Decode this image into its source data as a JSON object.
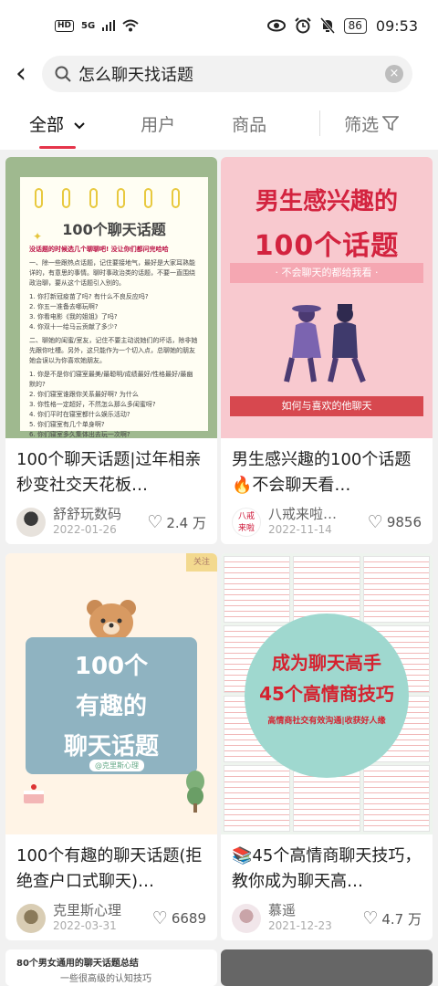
{
  "status": {
    "hd": "HD",
    "signal": "5G",
    "battery": "86",
    "time": "09:53"
  },
  "search": {
    "query": "怎么聊天找话题",
    "back": "‹",
    "clear": "×"
  },
  "tabs": {
    "all": "全部",
    "users": "用户",
    "goods": "商品",
    "filter": "筛选"
  },
  "cards": [
    {
      "title": "100个聊天话题|过年相亲秒变社交天花板…",
      "user": "舒舒玩数码",
      "date": "2022-01-26",
      "likes": "2.4 万",
      "thumb": {
        "title": "100个聊天话题",
        "lines": [
          "没话题的时候选几个聊聊吧! 没让你们都问完哈哈",
          "一、除一些跟热点话题，记住要接地气，最好是大家耳熟能详的，有意思的事情。聊时事政治类的话题，不要一直围绕政治聊，要从这个话题引入别的。",
          "1. 你打新冠疫苗了吗? 有什么不良反应吗?",
          "2. 你五一准备去哪玩啊?",
          "3. 你看电影《我的姐姐》了吗?",
          "4. 你双十一给马云贡献了多少?",
          "二、聊她的闺蜜/室友，记住不要主动说她们的坏话，除非她先跟你吐槽。另外，这只能作为一个切入点，总聊她的朋友她会误以为你喜欢她朋友。",
          "1. 你是不是你们寝室最美/最聪明/成绩最好/性格最好/最幽默的?",
          "2. 你们寝室谁跟你关系最好啊? 为什么",
          "3. 你性格一定超好，不然怎么那么多闺蜜呀?",
          "4. 你们平时在寝室都什么娱乐活动?",
          "5. 你们寝室有几个单身啊?",
          "6. 你们寝室多久集体出去玩一次啊?"
        ]
      }
    },
    {
      "title": "男生感兴趣的100个话题🔥不会聊天看…",
      "user": "八戒来啦…",
      "date": "2022-11-14",
      "likes": "9856",
      "thumb": {
        "h1": "男生感兴趣的",
        "h2": "100个话题",
        "sub": "· 不会聊天的都给我看 ·",
        "bar": "如何与喜欢的他聊天"
      }
    },
    {
      "title": "100个有趣的聊天话题(拒绝查户口式聊天)…",
      "user": "克里斯心理",
      "date": "2022-03-31",
      "likes": "6689",
      "thumb": {
        "l1": "100个",
        "l2": "有趣的",
        "l3": "聊天话题",
        "tag": "@克里斯心理",
        "corner": "关注"
      }
    },
    {
      "title": "📚45个高情商聊天技巧，教你成为聊天高…",
      "user": "慕遥",
      "date": "2021-12-23",
      "likes": "4.7 万",
      "thumb": {
        "l1": "成为聊天高手",
        "l2": "45个高情商技巧",
        "l3": "高情商社交有效沟通|收获好人缘"
      }
    },
    {
      "thumb": {
        "a": "80个男女通用的聊天话题总结",
        "b": "一些很高级的认知技巧"
      }
    },
    {
      "thumb": {}
    }
  ]
}
